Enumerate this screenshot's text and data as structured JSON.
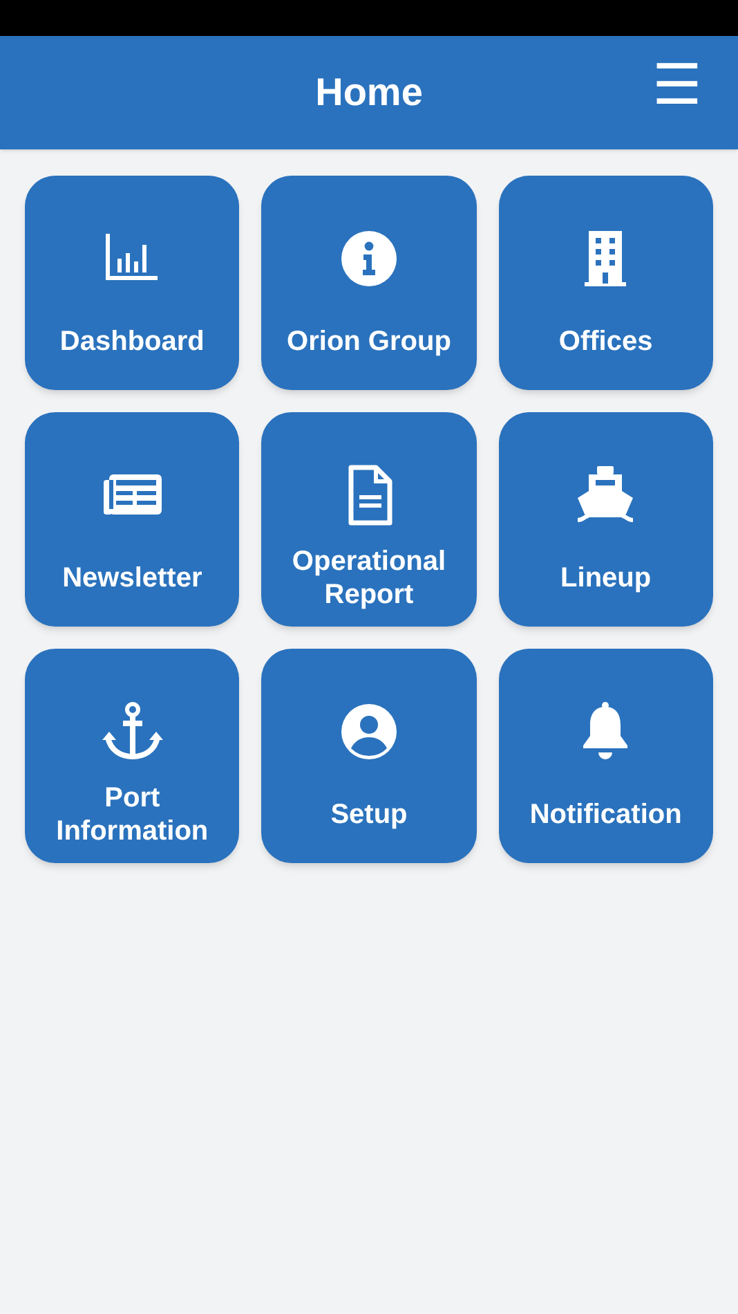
{
  "header": {
    "title": "Home",
    "menu_icon": "☰"
  },
  "tiles": [
    {
      "label": "Dashboard",
      "kind": "chart"
    },
    {
      "label": "Orion Group",
      "kind": "info"
    },
    {
      "label": "Offices",
      "kind": "building"
    },
    {
      "label": "Newsletter",
      "kind": "newspaper"
    },
    {
      "label": "Operational Report",
      "kind": "document"
    },
    {
      "label": "Lineup",
      "kind": "ship"
    },
    {
      "label": "Port Information",
      "kind": "anchor"
    },
    {
      "label": "Setup",
      "kind": "user"
    },
    {
      "label": "Notification",
      "kind": "bell"
    }
  ]
}
